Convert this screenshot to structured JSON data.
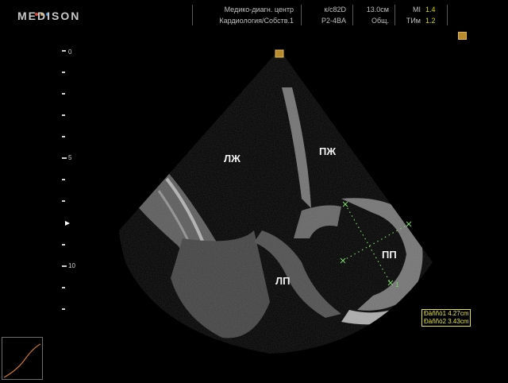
{
  "header": {
    "logo": "MEDISON",
    "logo_dot_colors": [
      "#d24a3a",
      "#d2a53a",
      "#3a8fd2"
    ],
    "clinic": "Медико-диагн. центр",
    "department": "Кардиология/Собств.1",
    "probe": "к/с82D",
    "preset": "P2-4BA",
    "depth": "13.0см",
    "mode": "Общ.",
    "mi_label": "MI",
    "mi_value": "1.4",
    "tim_label": "ТИм",
    "tim_value": "1.2"
  },
  "depth_scale": {
    "labels": [
      "0",
      "5",
      "10"
    ]
  },
  "chambers": {
    "lv": "ЛЖ",
    "rv": "ПЖ",
    "la": "ЛП",
    "ra": "ПП"
  },
  "measurements": {
    "m1": "Ðàññò1 4.27cm",
    "m2": "Ðàññò2 3.43cm"
  },
  "markers": {
    "caliper_end": "1"
  },
  "colors": {
    "measurement": "#e5e53a",
    "caliper": "#7bd66a",
    "icon": "#b78a2e"
  },
  "icons": [
    "focus-marker-icon",
    "orientation-marker-icon",
    "caliper-cross-icon",
    "gray-curve-icon"
  ]
}
